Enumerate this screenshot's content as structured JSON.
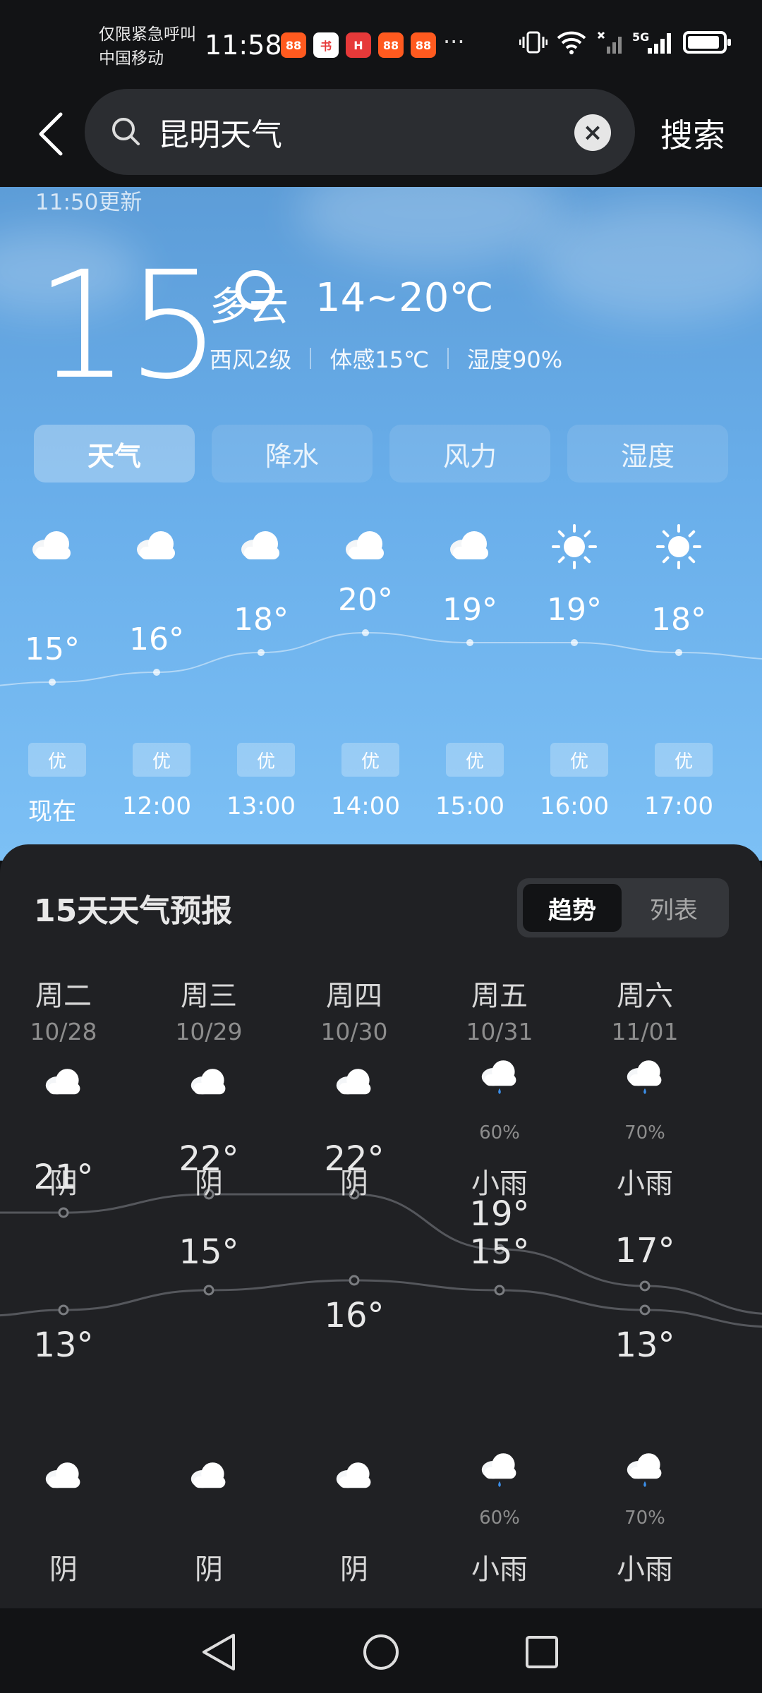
{
  "status_bar": {
    "carrier_line1": "仅限紧急呼叫",
    "carrier_line2": "中国移动",
    "time": "11:58",
    "dots": "···",
    "app_icons": [
      {
        "label": "88",
        "color": "#ff5a1f",
        "icon": "shopping-app-icon"
      },
      {
        "label": "书",
        "color": "#ffffff",
        "icon": "book-app-icon"
      },
      {
        "label": "H",
        "color": "#e63939",
        "icon": "huawei-app-icon"
      },
      {
        "label": "88",
        "color": "#ff5a1f",
        "icon": "shopping-app-icon"
      },
      {
        "label": "88",
        "color": "#ff5a1f",
        "icon": "shopping-app-icon"
      }
    ],
    "network": "5G"
  },
  "search": {
    "query": "昆明天气",
    "search_label": "搜索"
  },
  "current": {
    "updated": "11:50更新",
    "temperature": "15°",
    "condition": "多云",
    "range": "14~20℃",
    "wind": "西风2级",
    "feels_like": "体感15℃",
    "humidity": "湿度90%"
  },
  "tabs": [
    {
      "label": "天气",
      "active": true
    },
    {
      "label": "降水",
      "active": false
    },
    {
      "label": "风力",
      "active": false
    },
    {
      "label": "湿度",
      "active": false
    }
  ],
  "hourly": [
    {
      "time": "现在",
      "temp": "15°",
      "t": 15,
      "icon": "cloud-icon",
      "aqi": "优"
    },
    {
      "time": "12:00",
      "temp": "16°",
      "t": 16,
      "icon": "cloud-icon",
      "aqi": "优"
    },
    {
      "time": "13:00",
      "temp": "18°",
      "t": 18,
      "icon": "cloud-icon",
      "aqi": "优"
    },
    {
      "time": "14:00",
      "temp": "20°",
      "t": 20,
      "icon": "cloud-icon",
      "aqi": "优"
    },
    {
      "time": "15:00",
      "temp": "19°",
      "t": 19,
      "icon": "cloud-icon",
      "aqi": "优"
    },
    {
      "time": "16:00",
      "temp": "19°",
      "t": 19,
      "icon": "sun-icon",
      "aqi": "优"
    },
    {
      "time": "17:00",
      "temp": "18°",
      "t": 18,
      "icon": "sun-icon",
      "aqi": "优"
    }
  ],
  "forecast": {
    "title": "15天天气预报",
    "toggle": {
      "trend": "趋势",
      "list": "列表"
    },
    "days": [
      {
        "weekday": "周二",
        "date": "10/28",
        "day_cond": "阴",
        "day_icon": "cloud-icon",
        "day_prob": "",
        "high": "21°",
        "hi": 21,
        "low": "13°",
        "lo": 13,
        "night_cond": "阴",
        "night_icon": "cloud-icon",
        "night_prob": ""
      },
      {
        "weekday": "周三",
        "date": "10/29",
        "day_cond": "阴",
        "day_icon": "cloud-icon",
        "day_prob": "",
        "high": "22°",
        "hi": 22,
        "low": "15°",
        "lo": 15,
        "night_cond": "阴",
        "night_icon": "cloud-icon",
        "night_prob": ""
      },
      {
        "weekday": "周四",
        "date": "10/30",
        "day_cond": "阴",
        "day_icon": "cloud-icon",
        "day_prob": "",
        "high": "22°",
        "hi": 22,
        "low": "16°",
        "lo": 16,
        "night_cond": "阴",
        "night_icon": "cloud-icon",
        "night_prob": ""
      },
      {
        "weekday": "周五",
        "date": "10/31",
        "day_cond": "小雨",
        "day_icon": "rain-cloud-icon",
        "day_prob": "60%",
        "high": "19°",
        "hi": 19,
        "low": "15°",
        "lo": 15,
        "night_cond": "小雨",
        "night_icon": "rain-cloud-icon",
        "night_prob": "60%"
      },
      {
        "weekday": "周六",
        "date": "11/01",
        "day_cond": "小雨",
        "day_icon": "rain-cloud-icon",
        "day_prob": "70%",
        "high": "17°",
        "hi": 17,
        "low": "13°",
        "lo": 13,
        "night_cond": "小雨",
        "night_icon": "rain-cloud-icon",
        "night_prob": "70%"
      }
    ]
  },
  "colors": {
    "sky_top": "#5d9dd8",
    "sky_bottom": "#7cc0f5",
    "card_bg": "#202124",
    "rain_drop": "#3b8ee8"
  }
}
